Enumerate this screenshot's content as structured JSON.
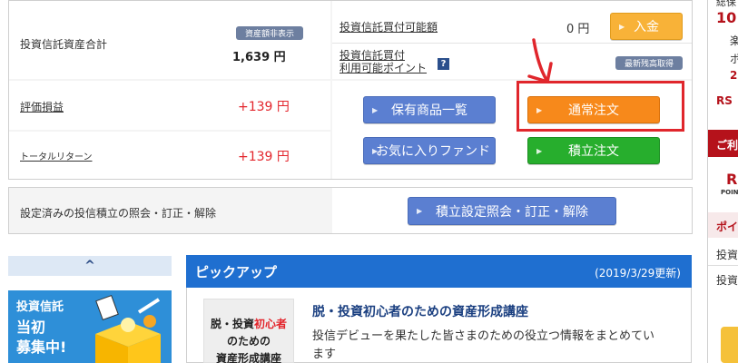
{
  "summary": {
    "total_label": "投資信託資産合計",
    "hide_badge": "資産額非表示",
    "total_value": "1,639 円",
    "buying_power_label": "投資信託買付可能額",
    "buying_power_value": "0 円",
    "deposit_button": "入金",
    "points_label_line1": "投資信託買付",
    "points_label_line2": "利用可能ポイント",
    "help_icon": "?",
    "refresh_badge": "最新残高取得",
    "pl_label": "評価損益",
    "pl_value": "+139 円",
    "total_return_label": "トータルリターン",
    "total_return_value": "+139 円"
  },
  "actions": {
    "holdings_button": "保有商品一覧",
    "normal_order_button": "通常注文",
    "favorites_button": "お気に入りファンド",
    "savings_order_button": "積立注文"
  },
  "settings": {
    "label": "設定済みの投信積立の照会・訂正・解除",
    "button": "積立設定照会・訂正・解除"
  },
  "sidebar": {
    "collapse_icon": "^",
    "ad_line1": "投資信託",
    "ad_line2": "当初",
    "ad_line3": "募集中!"
  },
  "pickup": {
    "title": "ピックアップ",
    "date": "(2019/3/29更新)",
    "thumb_line1_a": "脱・投資",
    "thumb_line1_b": "初心者",
    "thumb_line2": "のための",
    "thumb_line3": "資産形成講座",
    "article_title": "脱・投資初心者のための資産形成講座",
    "article_desc": "投信デビューを果たした皆さまのための役立つ情報をまとめています"
  },
  "rightbar": {
    "top_text": "総保",
    "amount": "10",
    "item1": "楽",
    "item2": "ポ",
    "item3": "2",
    "brand": "RS",
    "section_title": "ご利",
    "logo_r": "R",
    "logo_sub": "POIN",
    "section2": "ポイ",
    "link1": "投資",
    "link2": "投資"
  },
  "colors": {
    "accent_blue": "#5b7fd1",
    "orange": "#f7891b",
    "green": "#27ae2d",
    "red": "#e3242b",
    "pickup_blue": "#1f6fd0"
  }
}
